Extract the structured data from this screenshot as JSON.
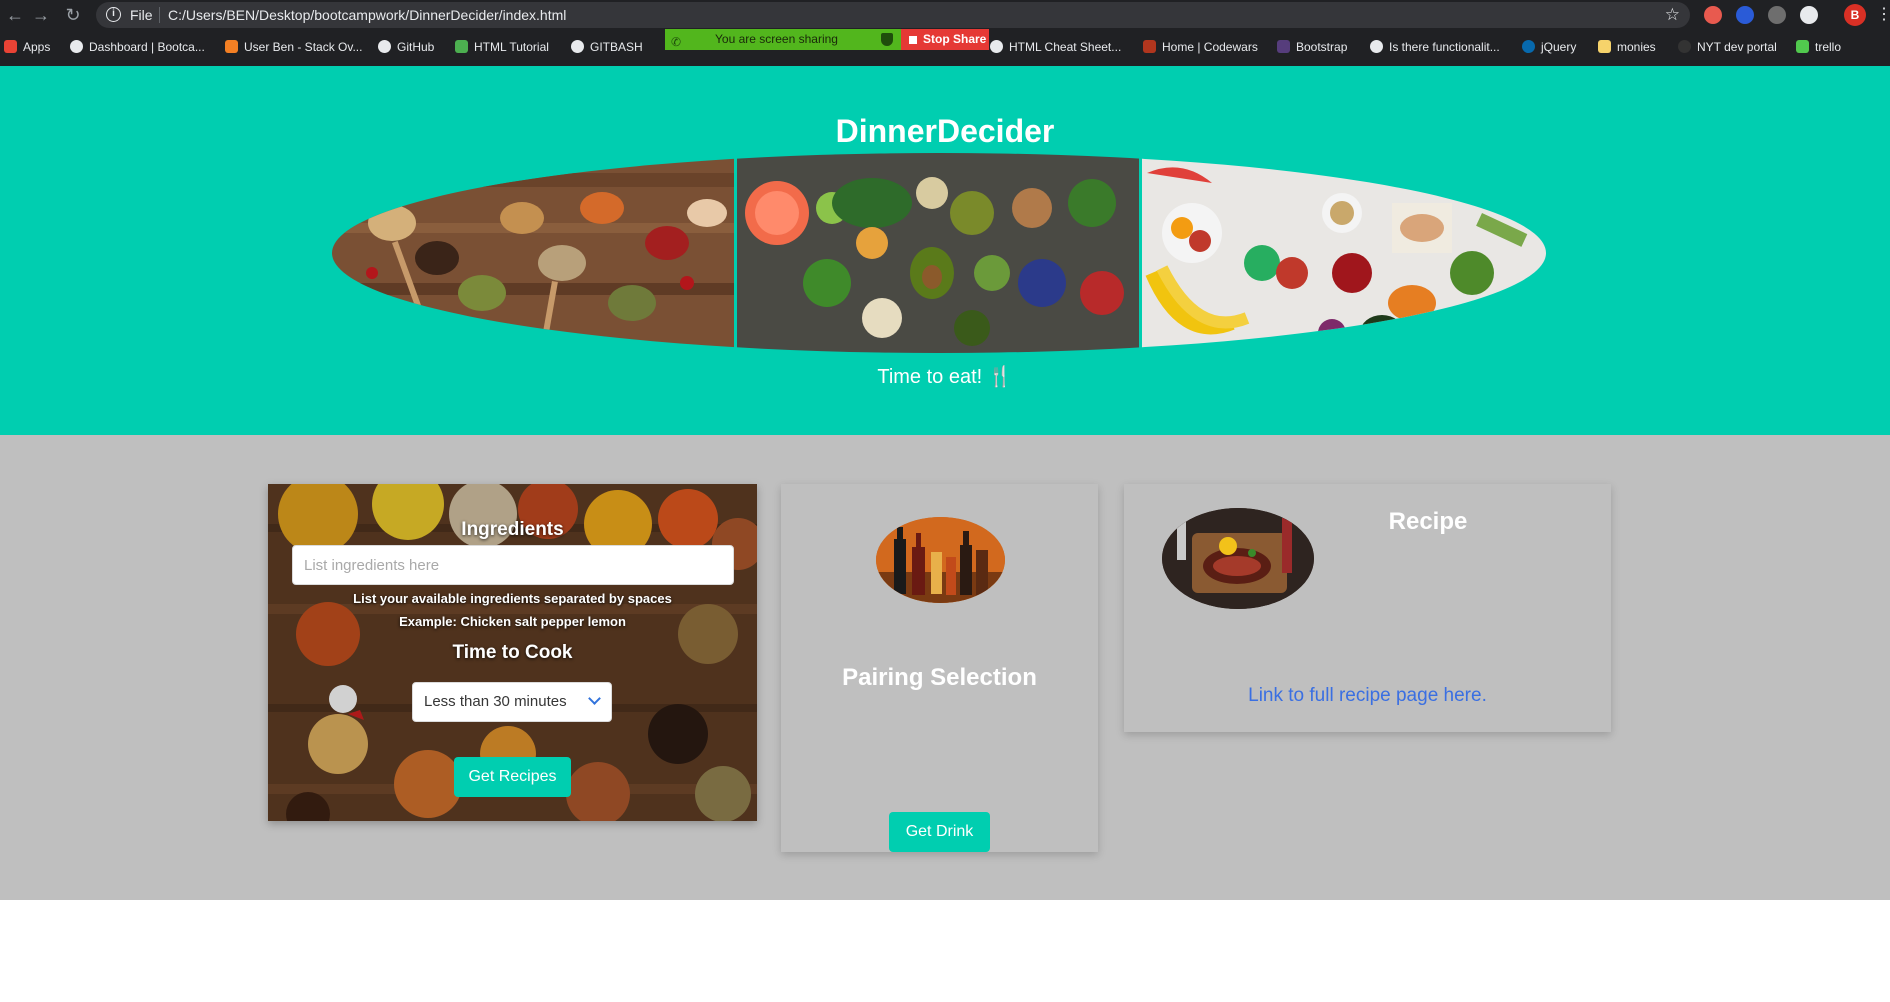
{
  "browser": {
    "file_label": "File",
    "url": "C:/Users/BEN/Desktop/bootcampwork/DinnerDecider/index.html",
    "profile_initial": "B",
    "bookmarks": [
      {
        "label": "Apps"
      },
      {
        "label": "Dashboard | Bootca..."
      },
      {
        "label": "User Ben - Stack Ov..."
      },
      {
        "label": "GitHub"
      },
      {
        "label": "HTML Tutorial"
      },
      {
        "label": "GITBASH"
      },
      {
        "label": "HTML Cheat Sheet..."
      },
      {
        "label": "Home | Codewars"
      },
      {
        "label": "Bootstrap"
      },
      {
        "label": "Is there functionalit..."
      },
      {
        "label": "jQuery"
      },
      {
        "label": "monies"
      },
      {
        "label": "NYT dev portal"
      },
      {
        "label": "trello"
      }
    ],
    "share_text": "You are screen sharing",
    "stop_share": "Stop Share"
  },
  "hero": {
    "title": "DinnerDecider",
    "tagline": "Time to eat! 🍴",
    "panels": [
      "spices-on-wooden-spoons",
      "vegetables-and-grains",
      "fruits-and-vegetables"
    ]
  },
  "ingredients": {
    "title": "Ingredients",
    "placeholder": "List ingredients here",
    "help_line1": "List your available ingredients separated by spaces",
    "help_line2": "Example: Chicken salt pepper lemon",
    "time_title": "Time to Cook",
    "time_selected": "Less than 30 minutes",
    "button": "Get Recipes"
  },
  "pairing": {
    "title": "Pairing Selection",
    "button": "Get Drink"
  },
  "recipe": {
    "title": "Recipe",
    "link": "Link to full recipe page here."
  },
  "colors": {
    "accent": "#00ceb0",
    "content_bg": "#bfbfbf",
    "link": "#3a6fe2"
  }
}
